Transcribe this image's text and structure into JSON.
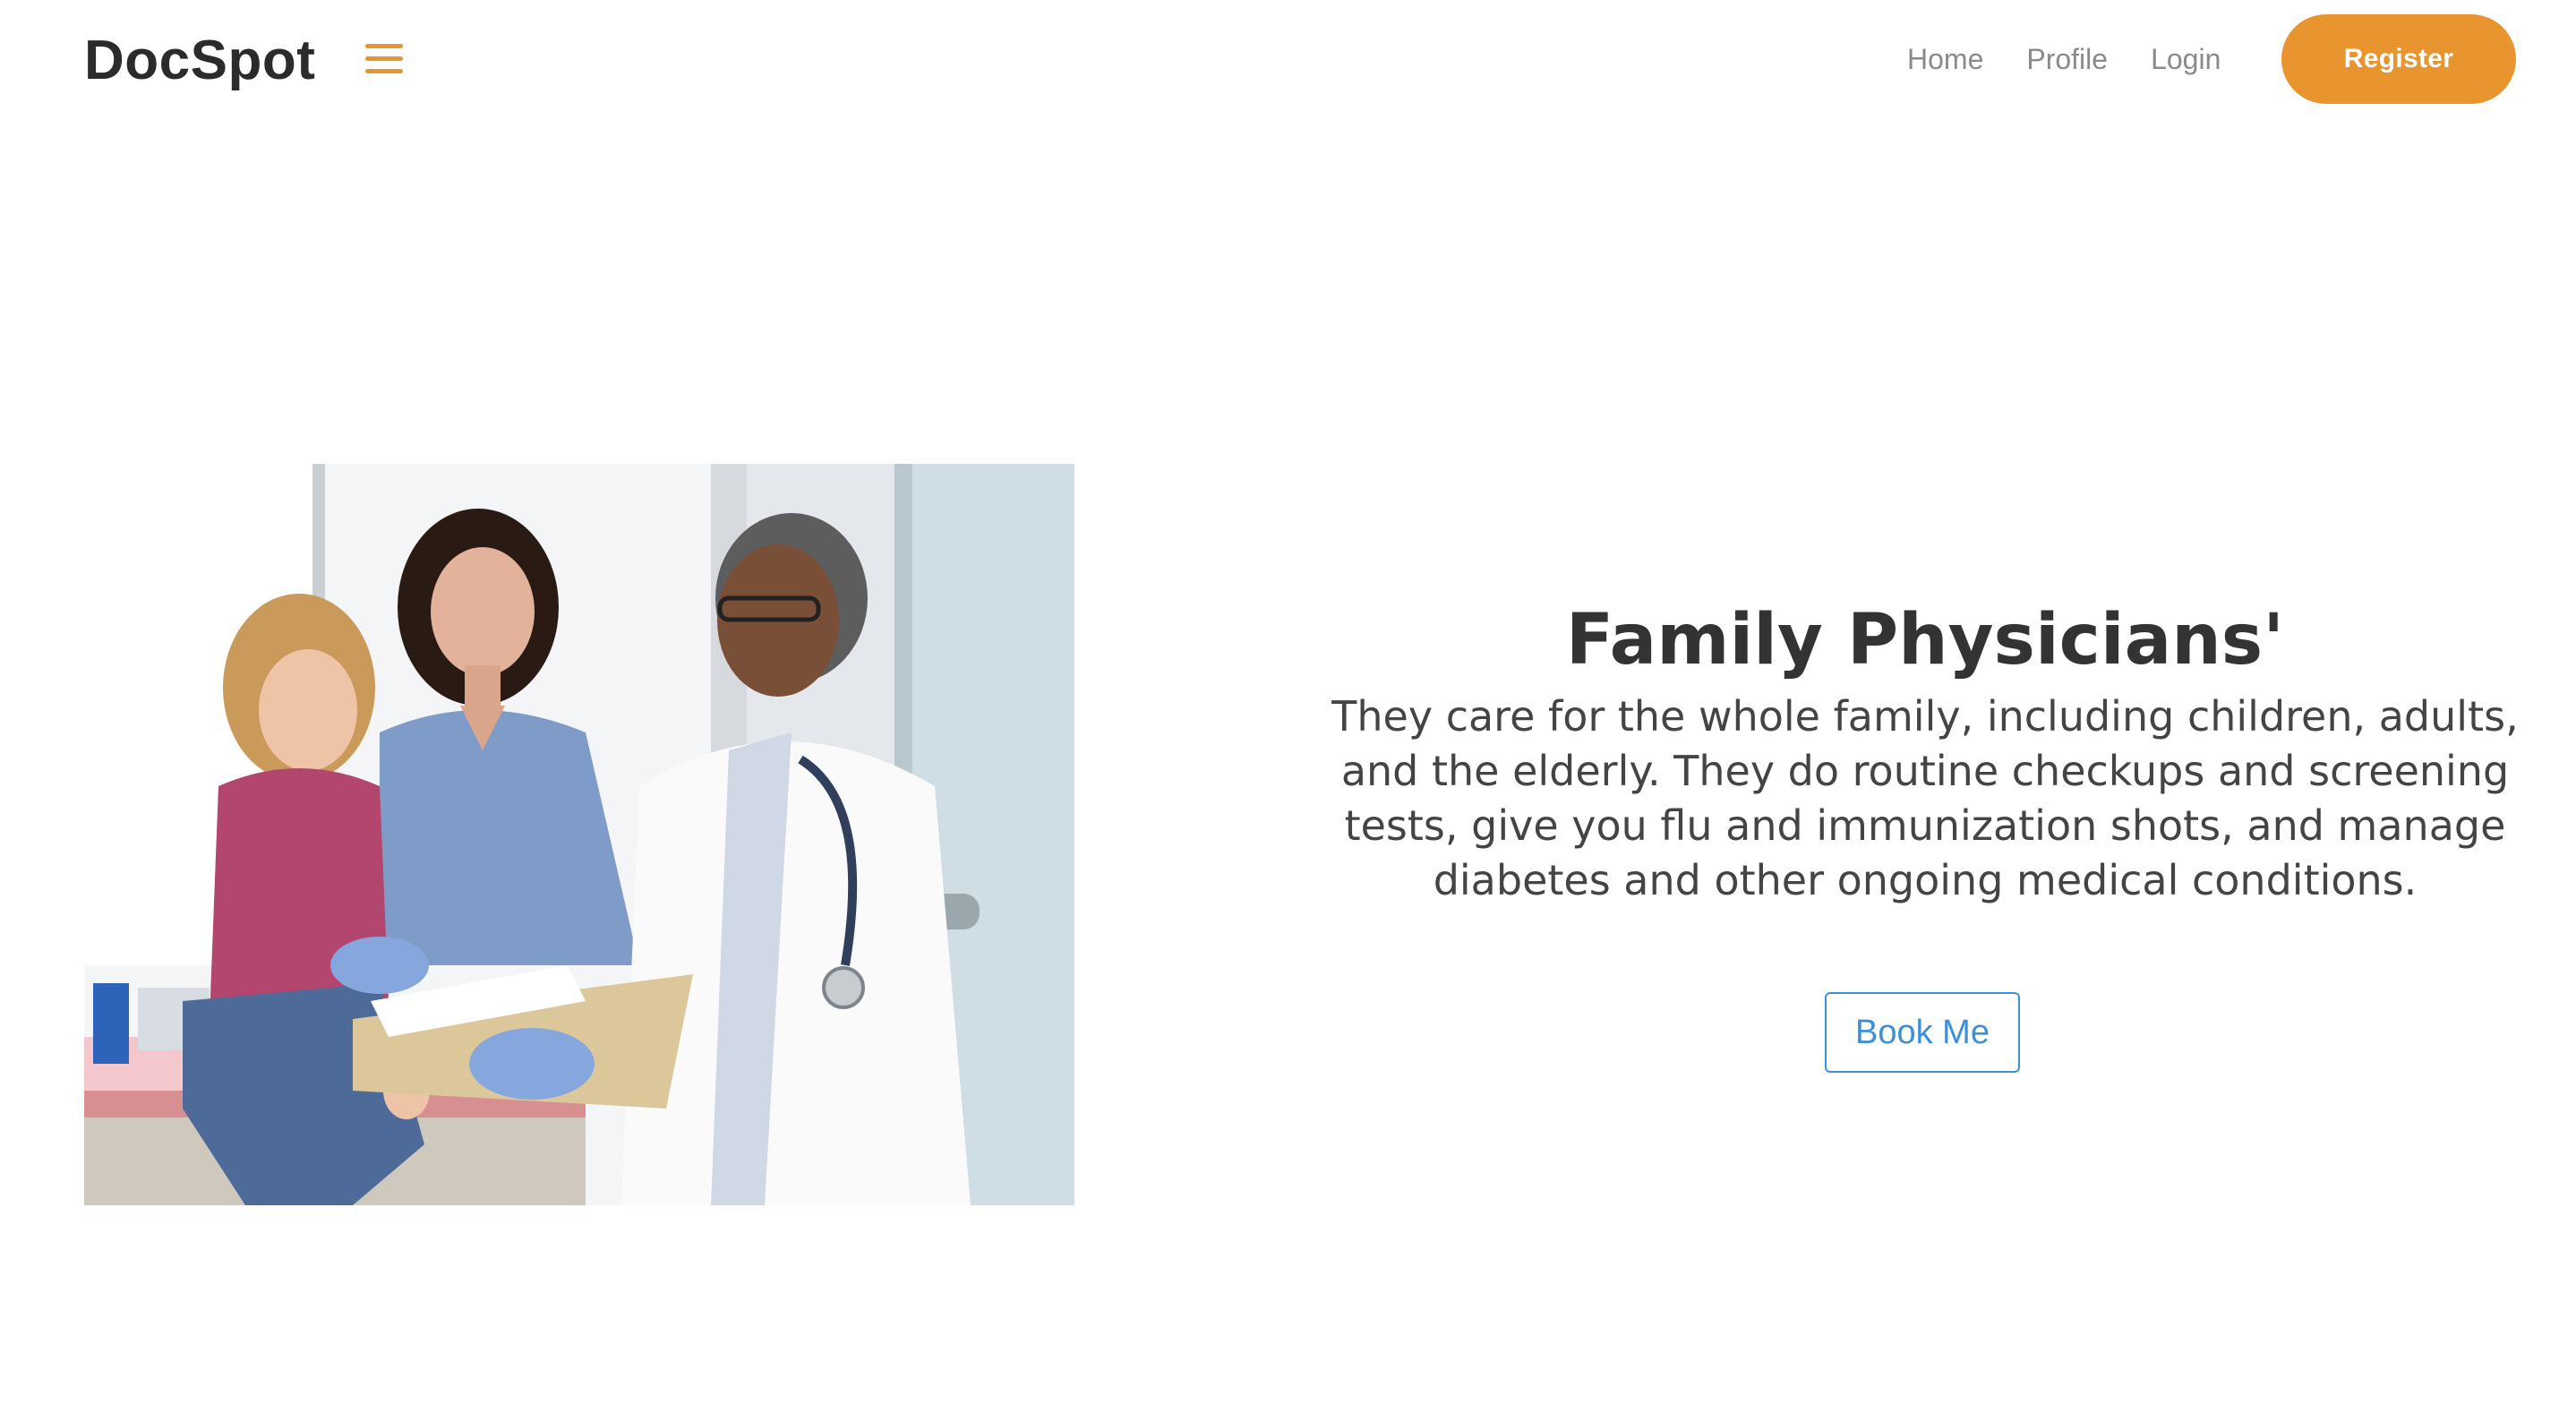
{
  "brand": "DocSpot",
  "nav": {
    "links": [
      "Home",
      "Profile",
      "Login"
    ],
    "register_label": "Register"
  },
  "hero": {
    "image_alt": "",
    "title": "Family Physicians'",
    "description": "They care for the whole family, including children, adults, and the elderly. They do routine checkups and screening tests, give you flu and immunization shots, and manage diabetes and other ongoing medical conditions.",
    "button_label": "Book Me"
  },
  "colors": {
    "accent": "#e8952f",
    "link_blue": "#3d8fd6",
    "text_dark": "#333333"
  }
}
